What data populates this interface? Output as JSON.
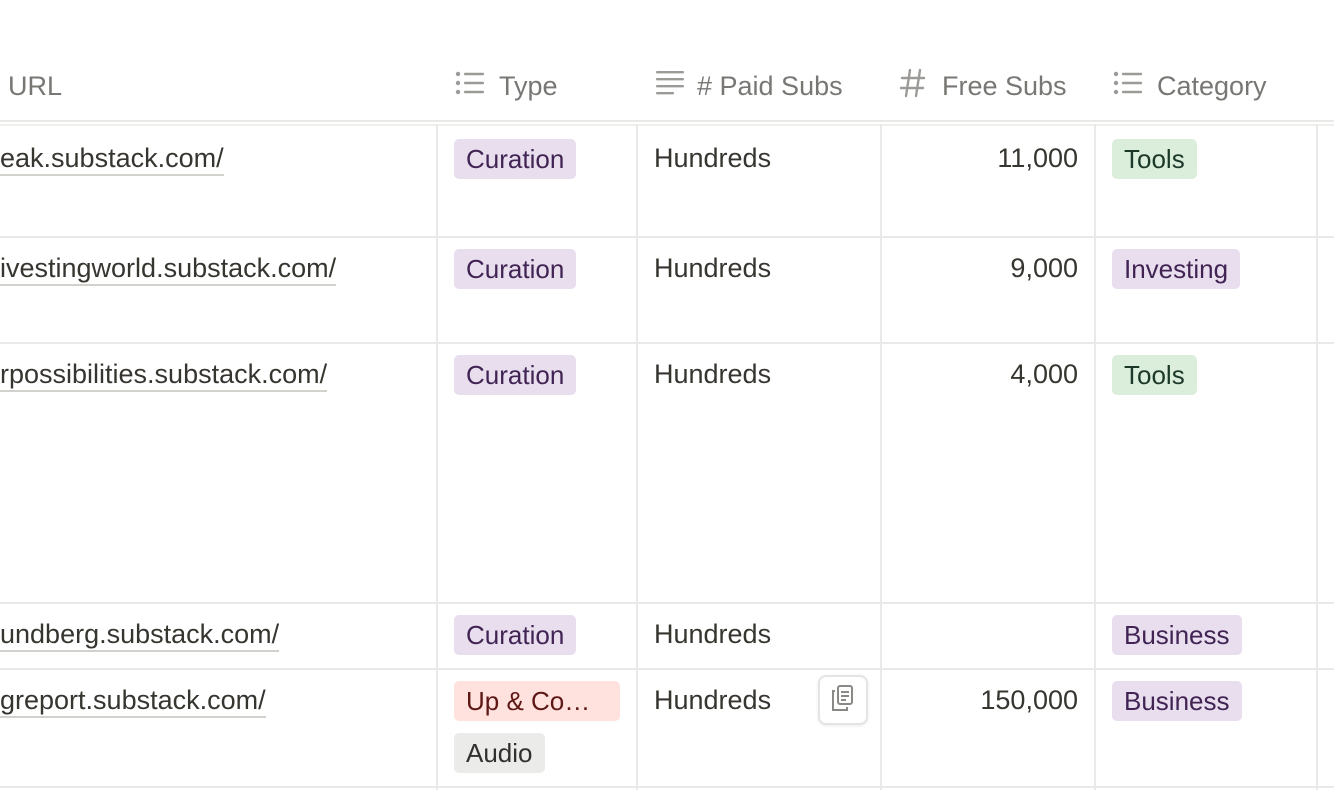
{
  "columns": {
    "url": "URL",
    "type": "Type",
    "paid_subs": "# Paid Subs",
    "free_subs": "Free Subs",
    "category": "Category"
  },
  "icons": {
    "type": "list-icon",
    "paid_subs": "text-lines-icon",
    "free_subs": "number-icon",
    "category": "list-icon",
    "copy": "copy-icon"
  },
  "colors": {
    "tag_purple_bg": "#e8deee",
    "tag_green_bg": "#dbeddb",
    "tag_red_bg": "#ffe2dd",
    "tag_gray_bg": "#ebebea"
  },
  "rows": [
    {
      "url": "eak.substack.com/",
      "types": [
        "Curation"
      ],
      "paid": "Hundreds",
      "free": "11,000",
      "category": "Tools"
    },
    {
      "url": "ivestingworld.substack.com/",
      "types": [
        "Curation"
      ],
      "paid": "Hundreds",
      "free": "9,000",
      "category": "Investing"
    },
    {
      "url": "rpossibilities.substack.com/",
      "types": [
        "Curation"
      ],
      "paid": "Hundreds",
      "free": "4,000",
      "category": "Tools"
    },
    {
      "url": "undberg.substack.com/",
      "types": [
        "Curation"
      ],
      "paid": "Hundreds",
      "free": "",
      "category": "Business"
    },
    {
      "url": "greport.substack.com/",
      "types": [
        "Up & Co…",
        "Audio"
      ],
      "paid": "Hundreds",
      "free": "150,000",
      "category": "Business"
    }
  ]
}
